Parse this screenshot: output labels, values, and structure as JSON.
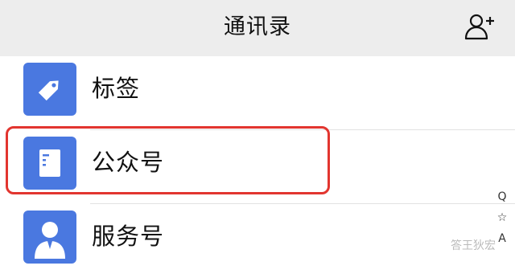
{
  "header": {
    "title": "通讯录",
    "add_icon": "add-contact-icon"
  },
  "list": {
    "items": [
      {
        "label": "标签",
        "icon": "tag-icon"
      },
      {
        "label": "公众号",
        "icon": "document-icon",
        "highlighted": true
      },
      {
        "label": "服务号",
        "icon": "person-icon"
      }
    ]
  },
  "index_bar": {
    "items": [
      "Q",
      "☆",
      "A"
    ]
  },
  "watermark": {
    "text": "答王狄宏"
  },
  "colors": {
    "header_bg": "#ededed",
    "icon_bg": "#4a78e0",
    "highlight": "#e2352f"
  }
}
